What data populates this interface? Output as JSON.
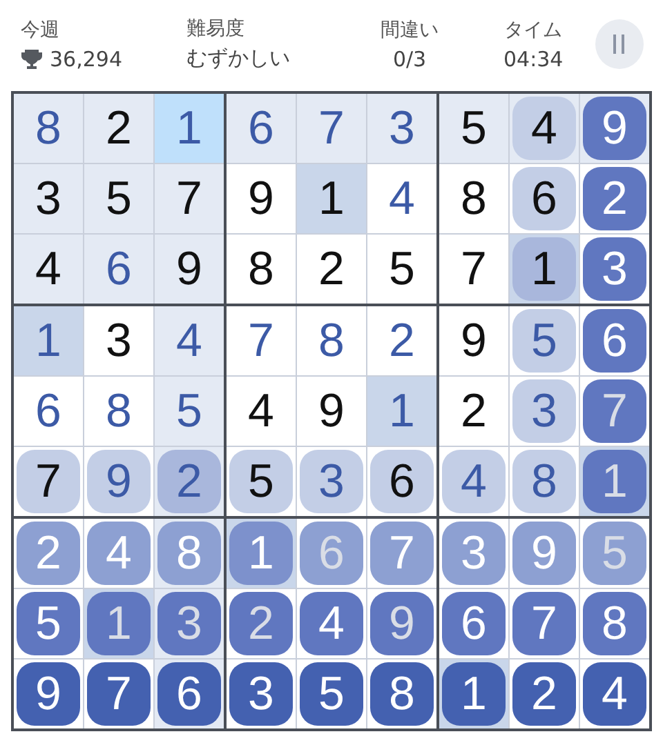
{
  "header": {
    "stats": [
      {
        "kind": "score",
        "label": "今週",
        "value": "36,294"
      },
      {
        "kind": "text",
        "label": "難易度",
        "value": "むずかしい"
      },
      {
        "kind": "center",
        "label": "間違い",
        "value": "0/3"
      },
      {
        "kind": "center",
        "label": "タイム",
        "value": "04:34"
      }
    ]
  },
  "board": {
    "rows": [
      [
        {
          "v": "8",
          "given": false,
          "highlighted": true,
          "selected": false,
          "same_number": false
        },
        {
          "v": "2",
          "given": true,
          "highlighted": true,
          "selected": false,
          "same_number": false
        },
        {
          "v": "1",
          "given": false,
          "highlighted": true,
          "selected": true,
          "same_number": false
        },
        {
          "v": "6",
          "given": false,
          "highlighted": true,
          "selected": false,
          "same_number": false
        },
        {
          "v": "7",
          "given": false,
          "highlighted": true,
          "selected": false,
          "same_number": false
        },
        {
          "v": "3",
          "given": false,
          "highlighted": true,
          "selected": false,
          "same_number": false
        },
        {
          "v": "5",
          "given": true,
          "highlighted": true,
          "selected": false,
          "same_number": false
        },
        {
          "v": "4",
          "given": true,
          "highlighted": true,
          "selected": false,
          "same_number": false,
          "color": "#c3cee6"
        },
        {
          "v": "9",
          "given": false,
          "highlighted": true,
          "selected": false,
          "same_number": false,
          "color": "#6077c0"
        }
      ],
      [
        {
          "v": "3",
          "given": true,
          "highlighted": true,
          "selected": false,
          "same_number": false
        },
        {
          "v": "5",
          "given": true,
          "highlighted": true,
          "selected": false,
          "same_number": false
        },
        {
          "v": "7",
          "given": true,
          "highlighted": true,
          "selected": false,
          "same_number": false
        },
        {
          "v": "9",
          "given": true,
          "highlighted": false,
          "selected": false,
          "same_number": false
        },
        {
          "v": "1",
          "given": true,
          "highlighted": false,
          "selected": false,
          "same_number": true
        },
        {
          "v": "4",
          "given": false,
          "highlighted": false,
          "selected": false,
          "same_number": false
        },
        {
          "v": "8",
          "given": true,
          "highlighted": false,
          "selected": false,
          "same_number": false
        },
        {
          "v": "6",
          "given": true,
          "highlighted": false,
          "selected": false,
          "same_number": false,
          "color": "#c3cee6"
        },
        {
          "v": "2",
          "given": false,
          "highlighted": false,
          "selected": false,
          "same_number": false,
          "color": "#6077c0"
        }
      ],
      [
        {
          "v": "4",
          "given": true,
          "highlighted": true,
          "selected": false,
          "same_number": false
        },
        {
          "v": "6",
          "given": false,
          "highlighted": true,
          "selected": false,
          "same_number": false
        },
        {
          "v": "9",
          "given": true,
          "highlighted": true,
          "selected": false,
          "same_number": false
        },
        {
          "v": "8",
          "given": true,
          "highlighted": false,
          "selected": false,
          "same_number": false
        },
        {
          "v": "2",
          "given": true,
          "highlighted": false,
          "selected": false,
          "same_number": false
        },
        {
          "v": "5",
          "given": true,
          "highlighted": false,
          "selected": false,
          "same_number": false
        },
        {
          "v": "7",
          "given": true,
          "highlighted": false,
          "selected": false,
          "same_number": false
        },
        {
          "v": "1",
          "given": true,
          "highlighted": false,
          "selected": false,
          "same_number": true,
          "color": "#a9b7dc"
        },
        {
          "v": "3",
          "given": false,
          "highlighted": false,
          "selected": false,
          "same_number": false,
          "color": "#6077c0"
        }
      ],
      [
        {
          "v": "1",
          "given": false,
          "highlighted": false,
          "selected": false,
          "same_number": true
        },
        {
          "v": "3",
          "given": true,
          "highlighted": false,
          "selected": false,
          "same_number": false
        },
        {
          "v": "4",
          "given": false,
          "highlighted": true,
          "selected": false,
          "same_number": false
        },
        {
          "v": "7",
          "given": false,
          "highlighted": false,
          "selected": false,
          "same_number": false
        },
        {
          "v": "8",
          "given": false,
          "highlighted": false,
          "selected": false,
          "same_number": false
        },
        {
          "v": "2",
          "given": false,
          "highlighted": false,
          "selected": false,
          "same_number": false
        },
        {
          "v": "9",
          "given": true,
          "highlighted": false,
          "selected": false,
          "same_number": false
        },
        {
          "v": "5",
          "given": false,
          "highlighted": false,
          "selected": false,
          "same_number": false,
          "color": "#c3cee6"
        },
        {
          "v": "6",
          "given": false,
          "highlighted": false,
          "selected": false,
          "same_number": false,
          "color": "#6077c0"
        }
      ],
      [
        {
          "v": "6",
          "given": false,
          "highlighted": false,
          "selected": false,
          "same_number": false
        },
        {
          "v": "8",
          "given": false,
          "highlighted": false,
          "selected": false,
          "same_number": false
        },
        {
          "v": "5",
          "given": false,
          "highlighted": true,
          "selected": false,
          "same_number": false
        },
        {
          "v": "4",
          "given": true,
          "highlighted": false,
          "selected": false,
          "same_number": false
        },
        {
          "v": "9",
          "given": true,
          "highlighted": false,
          "selected": false,
          "same_number": false
        },
        {
          "v": "1",
          "given": false,
          "highlighted": false,
          "selected": false,
          "same_number": true
        },
        {
          "v": "2",
          "given": true,
          "highlighted": false,
          "selected": false,
          "same_number": false
        },
        {
          "v": "3",
          "given": false,
          "highlighted": false,
          "selected": false,
          "same_number": false,
          "color": "#c3cee6"
        },
        {
          "v": "7",
          "given": true,
          "highlighted": false,
          "selected": false,
          "same_number": false,
          "color": "#6077c0"
        }
      ],
      [
        {
          "v": "7",
          "given": true,
          "highlighted": false,
          "selected": false,
          "same_number": false,
          "color": "#c3cee6"
        },
        {
          "v": "9",
          "given": false,
          "highlighted": false,
          "selected": false,
          "same_number": false,
          "color": "#c3cee6"
        },
        {
          "v": "2",
          "given": false,
          "highlighted": true,
          "selected": false,
          "same_number": false,
          "color": "#a9b7dc"
        },
        {
          "v": "5",
          "given": true,
          "highlighted": false,
          "selected": false,
          "same_number": false,
          "color": "#c3cee6"
        },
        {
          "v": "3",
          "given": false,
          "highlighted": false,
          "selected": false,
          "same_number": false,
          "color": "#c3cee6"
        },
        {
          "v": "6",
          "given": true,
          "highlighted": false,
          "selected": false,
          "same_number": false,
          "color": "#c3cee6"
        },
        {
          "v": "4",
          "given": false,
          "highlighted": false,
          "selected": false,
          "same_number": false,
          "color": "#c3cee6"
        },
        {
          "v": "8",
          "given": false,
          "highlighted": false,
          "selected": false,
          "same_number": false,
          "color": "#c3cee6"
        },
        {
          "v": "1",
          "given": true,
          "highlighted": false,
          "selected": false,
          "same_number": true,
          "color": "#6077c0"
        }
      ],
      [
        {
          "v": "2",
          "given": false,
          "highlighted": false,
          "selected": false,
          "same_number": false,
          "color": "#8da0d2"
        },
        {
          "v": "4",
          "given": false,
          "highlighted": false,
          "selected": false,
          "same_number": false,
          "color": "#8da0d2"
        },
        {
          "v": "8",
          "given": false,
          "highlighted": true,
          "selected": false,
          "same_number": false,
          "color": "#8da0d2"
        },
        {
          "v": "1",
          "given": false,
          "highlighted": false,
          "selected": false,
          "same_number": true,
          "color": "#7d91cc"
        },
        {
          "v": "6",
          "given": true,
          "highlighted": false,
          "selected": false,
          "same_number": false,
          "color": "#8da0d2"
        },
        {
          "v": "7",
          "given": false,
          "highlighted": false,
          "selected": false,
          "same_number": false,
          "color": "#8da0d2"
        },
        {
          "v": "3",
          "given": false,
          "highlighted": false,
          "selected": false,
          "same_number": false,
          "color": "#8da0d2"
        },
        {
          "v": "9",
          "given": false,
          "highlighted": false,
          "selected": false,
          "same_number": false,
          "color": "#8da0d2"
        },
        {
          "v": "5",
          "given": true,
          "highlighted": false,
          "selected": false,
          "same_number": false,
          "color": "#8da0d2"
        }
      ],
      [
        {
          "v": "5",
          "given": false,
          "highlighted": false,
          "selected": false,
          "same_number": false,
          "color": "#6077c0"
        },
        {
          "v": "1",
          "given": true,
          "highlighted": false,
          "selected": false,
          "same_number": true,
          "color": "#6077c0"
        },
        {
          "v": "3",
          "given": true,
          "highlighted": true,
          "selected": false,
          "same_number": false,
          "color": "#6077c0"
        },
        {
          "v": "2",
          "given": true,
          "highlighted": false,
          "selected": false,
          "same_number": false,
          "color": "#6077c0"
        },
        {
          "v": "4",
          "given": false,
          "highlighted": false,
          "selected": false,
          "same_number": false,
          "color": "#6077c0"
        },
        {
          "v": "9",
          "given": true,
          "highlighted": false,
          "selected": false,
          "same_number": false,
          "color": "#6077c0"
        },
        {
          "v": "6",
          "given": false,
          "highlighted": false,
          "selected": false,
          "same_number": false,
          "color": "#6077c0"
        },
        {
          "v": "7",
          "given": false,
          "highlighted": false,
          "selected": false,
          "same_number": false,
          "color": "#6077c0"
        },
        {
          "v": "8",
          "given": false,
          "highlighted": false,
          "selected": false,
          "same_number": false,
          "color": "#6077c0"
        }
      ],
      [
        {
          "v": "9",
          "given": false,
          "highlighted": false,
          "selected": false,
          "same_number": false,
          "color": "#4461b0"
        },
        {
          "v": "7",
          "given": false,
          "highlighted": false,
          "selected": false,
          "same_number": false,
          "color": "#4461b0"
        },
        {
          "v": "6",
          "given": false,
          "highlighted": true,
          "selected": false,
          "same_number": false,
          "color": "#4461b0"
        },
        {
          "v": "3",
          "given": false,
          "highlighted": false,
          "selected": false,
          "same_number": false,
          "color": "#4461b0"
        },
        {
          "v": "5",
          "given": false,
          "highlighted": false,
          "selected": false,
          "same_number": false,
          "color": "#4461b0"
        },
        {
          "v": "8",
          "given": false,
          "highlighted": false,
          "selected": false,
          "same_number": false,
          "color": "#4461b0"
        },
        {
          "v": "1",
          "given": false,
          "highlighted": false,
          "selected": false,
          "same_number": true,
          "color": "#4461b0"
        },
        {
          "v": "2",
          "given": false,
          "highlighted": false,
          "selected": false,
          "same_number": false,
          "color": "#4461b0"
        },
        {
          "v": "4",
          "given": false,
          "highlighted": false,
          "selected": false,
          "same_number": false,
          "color": "#4461b0"
        }
      ]
    ]
  }
}
